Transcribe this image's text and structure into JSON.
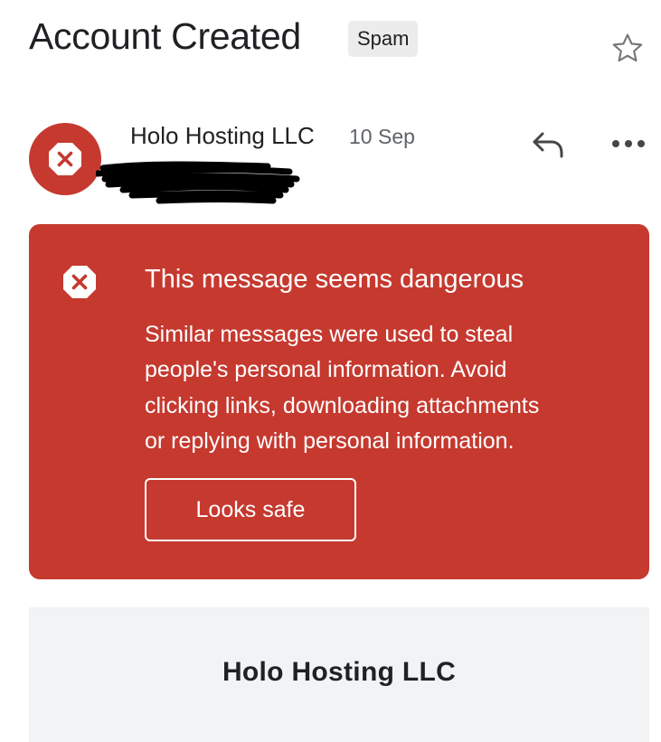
{
  "email": {
    "subject": "Account Created",
    "label": "Spam",
    "sender": "Holo Hosting LLC",
    "date": "10 Sep"
  },
  "warning": {
    "title": "This message seems dangerous",
    "body_lines": [
      "Similar messages were used to steal",
      "people's personal information. Avoid",
      "clicking links, downloading attachments",
      "or replying with personal information."
    ],
    "button_label": "Looks safe"
  },
  "body_preview": {
    "heading": "Holo Hosting LLC"
  },
  "colors": {
    "danger": "#c5392f",
    "text": "#202124",
    "muted": "#5f6368",
    "badge_bg": "#ececec",
    "content_bg": "#f1f3f4"
  },
  "icons": [
    "star-icon",
    "avatar-error-icon",
    "reply-icon",
    "more-options-icon",
    "warning-error-icon"
  ]
}
